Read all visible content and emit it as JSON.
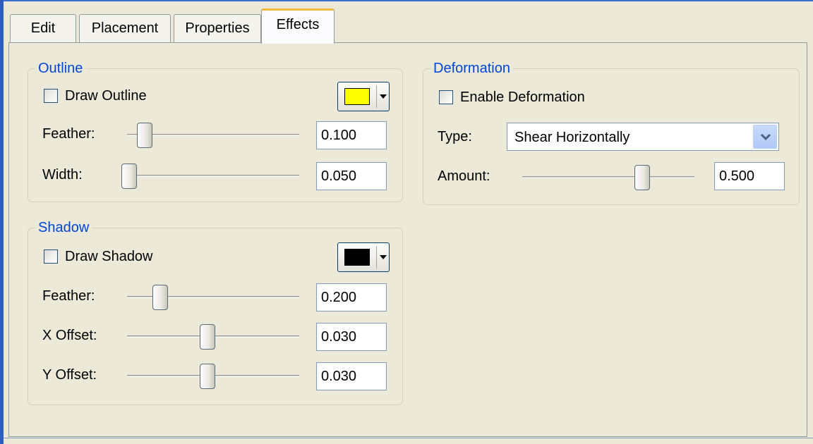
{
  "tabs": [
    {
      "label": "Edit",
      "active": false
    },
    {
      "label": "Placement",
      "active": false
    },
    {
      "label": "Properties",
      "active": false
    },
    {
      "label": "Effects",
      "active": true
    }
  ],
  "outline": {
    "title": "Outline",
    "draw_label": "Draw Outline",
    "draw_checked": false,
    "color": "#ffff00",
    "feather": {
      "label": "Feather:",
      "value": "0.100",
      "level": 0.1
    },
    "width": {
      "label": "Width:",
      "value": "0.050",
      "level": 0.0
    }
  },
  "shadow": {
    "title": "Shadow",
    "draw_label": "Draw Shadow",
    "draw_checked": false,
    "color": "#000000",
    "feather": {
      "label": "Feather:",
      "value": "0.200",
      "level": 0.2
    },
    "x_offset": {
      "label": "X Offset:",
      "value": "0.030",
      "level": 0.5
    },
    "y_offset": {
      "label": "Y Offset:",
      "value": "0.030",
      "level": 0.5
    }
  },
  "deformation": {
    "title": "Deformation",
    "enable_label": "Enable Deformation",
    "enable_checked": false,
    "type_label": "Type:",
    "type_value": "Shear Horizontally",
    "amount": {
      "label": "Amount:",
      "value": "0.500",
      "level": 0.75
    }
  }
}
